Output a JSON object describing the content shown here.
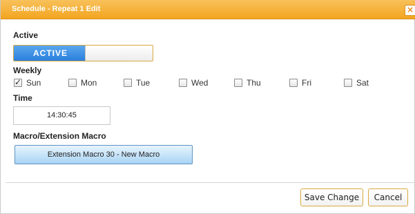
{
  "dialog": {
    "title": "Schedule - Repeat 1 Edit",
    "close_glyph": "×"
  },
  "active": {
    "label": "Active",
    "toggle_text": "ACTIVE",
    "state": "on"
  },
  "weekly": {
    "label": "Weekly",
    "days": [
      {
        "label": "Sun",
        "checked": true
      },
      {
        "label": "Mon",
        "checked": false
      },
      {
        "label": "Tue",
        "checked": false
      },
      {
        "label": "Wed",
        "checked": false
      },
      {
        "label": "Thu",
        "checked": false
      },
      {
        "label": "Fri",
        "checked": false
      },
      {
        "label": "Sat",
        "checked": false
      }
    ]
  },
  "time": {
    "label": "Time",
    "value": "14:30:45"
  },
  "macro": {
    "label": "Macro/Extension Macro",
    "value": "Extension Macro 30 - New Macro"
  },
  "footer": {
    "save_label": "Save Change",
    "cancel_label": "Cancel"
  },
  "colors": {
    "titlebar": "#f3a521",
    "toggle_on": "#2a7fdc",
    "button_border": "#d8a93e",
    "macro_button": "#a8d4f4"
  },
  "icons": {
    "close": "close-icon",
    "checkbox_checked": "checkmark-icon"
  }
}
